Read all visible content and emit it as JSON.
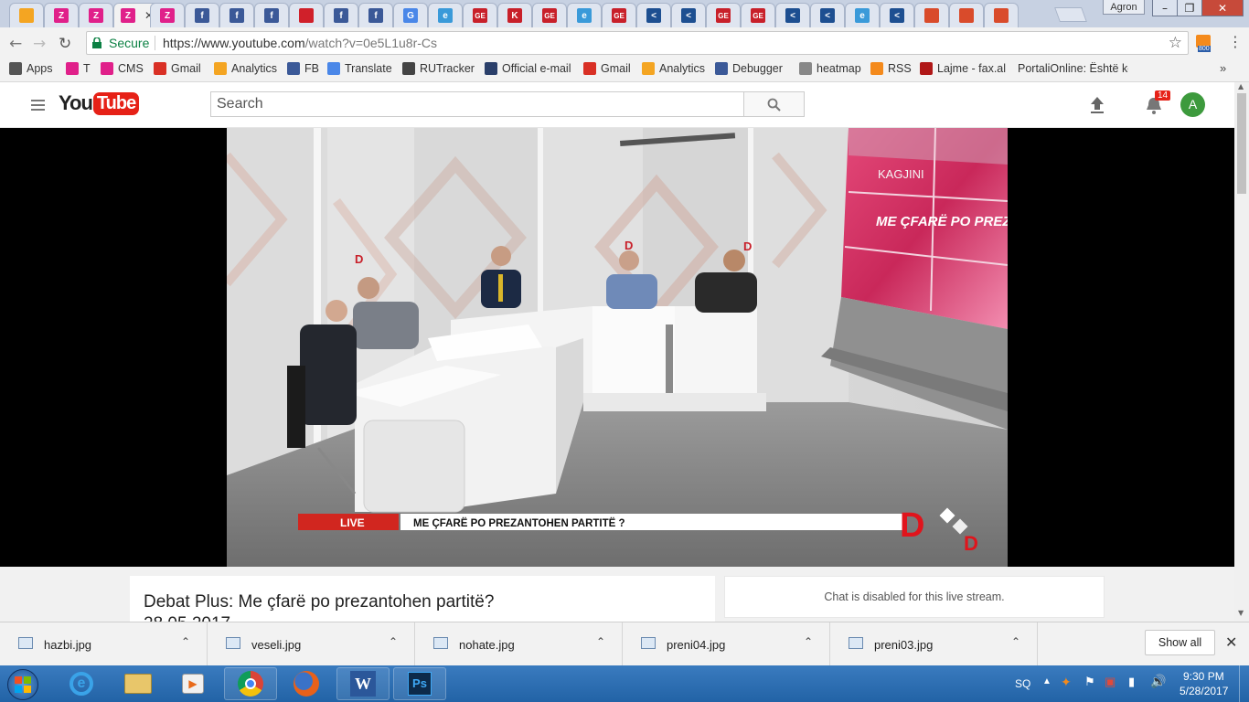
{
  "browser": {
    "tabs": [
      {
        "icon": "analytics-tab-icon",
        "letter": "",
        "color": "#f4a522"
      },
      {
        "icon": "z-tab-icon",
        "letter": "Z",
        "color": "#e0208a"
      },
      {
        "icon": "z-tab-icon",
        "letter": "Z",
        "color": "#e0208a"
      },
      {
        "icon": "z-tab-icon",
        "letter": "Z",
        "color": "#e0208a"
      },
      {
        "icon": "z-tab-icon",
        "letter": "Z",
        "color": "#e0208a"
      },
      {
        "icon": "facebook-tab-icon",
        "letter": "f",
        "color": "#3b5998"
      },
      {
        "icon": "facebook-tab-icon",
        "letter": "f",
        "color": "#3b5998"
      },
      {
        "icon": "facebook-tab-icon",
        "letter": "f",
        "color": "#3b5998"
      },
      {
        "icon": "news-tab-icon",
        "letter": "",
        "color": "#d0202a"
      },
      {
        "icon": "facebook-tab-icon",
        "letter": "f",
        "color": "#3b5998"
      },
      {
        "icon": "facebook-tab-icon",
        "letter": "f",
        "color": "#3b5998"
      },
      {
        "icon": "translate-tab-icon",
        "letter": "G",
        "color": "#4a87e8"
      },
      {
        "icon": "edge-tab-icon",
        "letter": "e",
        "color": "#3a9ad9"
      },
      {
        "icon": "ge-tab-icon",
        "letter": "GE",
        "color": "#c8202a"
      },
      {
        "icon": "k-tab-icon",
        "letter": "K",
        "color": "#c8202a"
      },
      {
        "icon": "ge-tab-icon",
        "letter": "GE",
        "color": "#c8202a"
      },
      {
        "icon": "edge-tab-icon",
        "letter": "e",
        "color": "#3a9ad9"
      },
      {
        "icon": "ge-tab-icon",
        "letter": "GE",
        "color": "#c8202a"
      },
      {
        "icon": "arrow-tab-icon",
        "letter": "<",
        "color": "#1d4f91"
      },
      {
        "icon": "arrow-tab-icon",
        "letter": "<",
        "color": "#1d4f91"
      },
      {
        "icon": "ge-tab-icon",
        "letter": "GE",
        "color": "#c8202a"
      },
      {
        "icon": "ge-tab-icon",
        "letter": "GE",
        "color": "#c8202a"
      },
      {
        "icon": "arrow-tab-icon",
        "letter": "<",
        "color": "#1d4f91"
      },
      {
        "icon": "arrow-tab-icon",
        "letter": "<",
        "color": "#1d4f91"
      },
      {
        "icon": "edge-tab-icon",
        "letter": "e",
        "color": "#3a9ad9"
      },
      {
        "icon": "arrow-tab-icon",
        "letter": "<",
        "color": "#1d4f91"
      },
      {
        "icon": "flask-tab-icon",
        "letter": "",
        "color": "#d94b2b"
      },
      {
        "icon": "flask-tab-icon",
        "letter": "",
        "color": "#d94b2b"
      },
      {
        "icon": "flask-tab-icon",
        "letter": "",
        "color": "#d94b2b"
      }
    ],
    "active_tab_index": 3,
    "window_user": "Agron",
    "secure_label": "Secure",
    "url_host": "https://www.youtube.com",
    "url_path": "/watch?v=0e5L1u8r-Cs",
    "extension_badge": "800",
    "bookmarks": [
      {
        "label": "Apps",
        "icon": "apps-icon",
        "color": "#555"
      },
      {
        "label": "T",
        "icon": "z-bookmark-icon",
        "color": "#e0208a"
      },
      {
        "label": "CMS",
        "icon": "z-bookmark-icon",
        "color": "#e0208a"
      },
      {
        "label": "Gmail",
        "icon": "gmail-icon",
        "color": "#d93025"
      },
      {
        "label": "Analytics",
        "icon": "analytics-icon",
        "color": "#f4a522"
      },
      {
        "label": "FB",
        "icon": "facebook-icon",
        "color": "#3b5998"
      },
      {
        "label": "Translate",
        "icon": "translate-icon",
        "color": "#4a87e8"
      },
      {
        "label": "RUTracker",
        "icon": "rutracker-icon",
        "color": "#444"
      },
      {
        "label": "Official e-mail",
        "icon": "shield-icon",
        "color": "#2a3f6a"
      },
      {
        "label": "Gmail",
        "icon": "gmail-icon",
        "color": "#d93025"
      },
      {
        "label": "Analytics",
        "icon": "analytics-icon",
        "color": "#f4a522"
      },
      {
        "label": "Debugger",
        "icon": "facebook-icon",
        "color": "#3b5998"
      },
      {
        "label": "heatmap",
        "icon": "page-icon",
        "color": "#888"
      },
      {
        "label": "RSS",
        "icon": "rss-icon",
        "color": "#f48a1c"
      },
      {
        "label": "Lajme - fax.al",
        "icon": "fax-icon",
        "color": "#b01818"
      },
      {
        "label": "PortaliOnline: Është kohë",
        "icon": "fax-icon",
        "color": "#b01818"
      }
    ]
  },
  "youtube": {
    "logo_you": "You",
    "logo_tube": "Tube",
    "search_placeholder": "Search",
    "notification_count": "14",
    "avatar_letter": "A",
    "video_title": "Debat Plus: Me çfarë po prezantohen partitë?",
    "video_date": "28.05.2017",
    "chat_message": "Chat is disabled for this live stream."
  },
  "video_overlay": {
    "live_label": "LIVE",
    "ticker_text": "ME ÇFARË PO PREZANTOHEN PARTITË ?",
    "screen_text": "ME ÇFARË PO PREZANTO",
    "screen_brand": "KAGJINI",
    "brand_mark": "D"
  },
  "downloads": {
    "items": [
      "hazbi.jpg",
      "veseli.jpg",
      "nohate.jpg",
      "preni04.jpg",
      "preni03.jpg"
    ],
    "show_all_label": "Show all"
  },
  "taskbar": {
    "language": "SQ",
    "time": "9:30 PM",
    "date": "5/28/2017"
  }
}
